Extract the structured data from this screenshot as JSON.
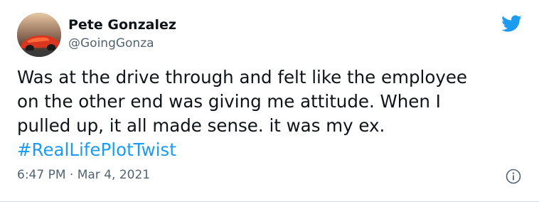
{
  "tweet": {
    "author_name": "Pete Gonzalez",
    "author_handle": "@GoingGonza",
    "text_lines": [
      "Was at the drive through and felt like the employee",
      "on the other end was giving me attitude. When I",
      "pulled up, it all made sense. it was my ex."
    ],
    "hashtag": "#RealLifePlotTwist",
    "time": "6:47 PM",
    "separator": "·",
    "date": "Mar 4, 2021"
  },
  "icons": {
    "brand": "twitter-bird-icon",
    "info": "info-icon"
  },
  "colors": {
    "brand_blue": "#1d9bf0",
    "text": "#0f1419",
    "muted": "#536471"
  }
}
